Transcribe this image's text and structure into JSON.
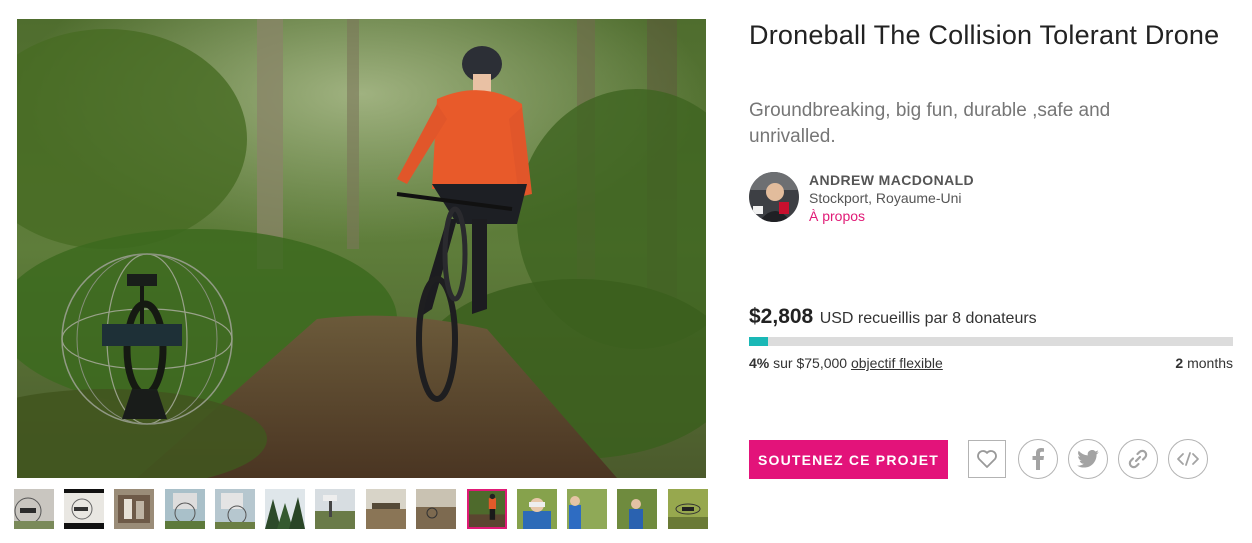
{
  "campaign": {
    "title": "Droneball The Collision Tolerant Drone",
    "blurb": "Groundbreaking, big fun, durable ,safe and unrivalled."
  },
  "owner": {
    "name": "ANDREW MACDONALD",
    "location": "Stockport, Royaume-Uni",
    "about_link": "À propos"
  },
  "funding": {
    "amount_raised": "$2,808",
    "raised_text": "USD recueillis par 8 donateurs",
    "percent_label": "4%",
    "percent_value": 0.04,
    "goal_text": "sur $75,000",
    "goal_type_link": "objectif flexible",
    "time_left_number": "2",
    "time_left_unit": "months"
  },
  "actions": {
    "back_button": "SOUTENEZ CE PROJET",
    "icons": [
      "heart-icon",
      "facebook-icon",
      "twitter-icon",
      "link-icon",
      "embed-code-icon"
    ]
  },
  "gallery": {
    "thumbnail_count": 14,
    "active_index": 9
  },
  "colors": {
    "accent": "#e3137a",
    "progress": "#1ab8b6",
    "link": "#e01a76"
  }
}
